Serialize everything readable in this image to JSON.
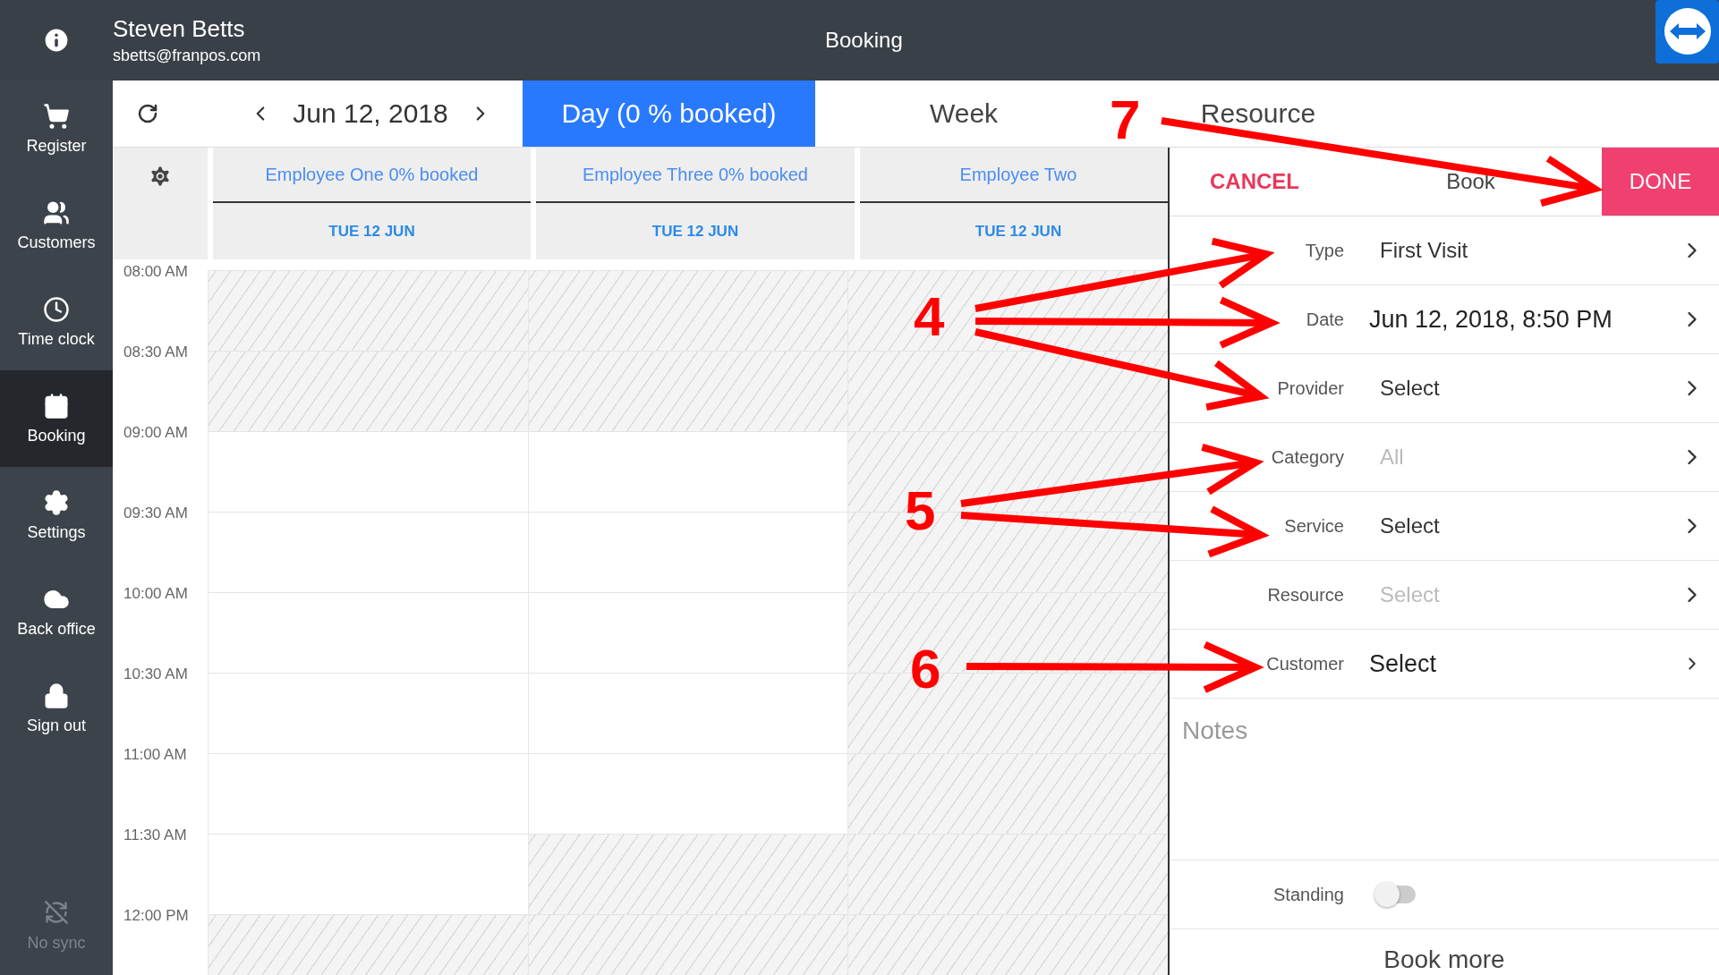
{
  "header": {
    "user_name": "Steven Betts",
    "user_email": "sbetts@franpos.com",
    "title": "Booking"
  },
  "sidebar": {
    "items": [
      {
        "label": "Register",
        "selected": false
      },
      {
        "label": "Customers",
        "selected": false
      },
      {
        "label": "Time clock",
        "selected": false
      },
      {
        "label": "Booking",
        "selected": true
      },
      {
        "label": "Settings",
        "selected": false
      },
      {
        "label": "Back office",
        "selected": false
      },
      {
        "label": "Sign out",
        "selected": false
      }
    ],
    "sync": {
      "label": "No sync",
      "disabled": true
    }
  },
  "toolbar": {
    "date": "Jun 12, 2018",
    "tabs": [
      {
        "label": "Day (0 % booked)",
        "selected": true
      },
      {
        "label": "Week",
        "selected": false
      },
      {
        "label": "Resource",
        "selected": false
      }
    ]
  },
  "calendar": {
    "times": [
      "08:00 AM",
      "08:30 AM",
      "09:00 AM",
      "09:30 AM",
      "10:00 AM",
      "10:30 AM",
      "11:00 AM",
      "11:30 AM",
      "12:00 PM"
    ],
    "columns": [
      {
        "name": "Employee One 0% booked",
        "date": "TUE 12 JUN",
        "slots": [
          {
            "blocked": true
          },
          {
            "blocked": true
          },
          {
            "blocked": false
          },
          {
            "blocked": false
          },
          {
            "blocked": false
          },
          {
            "blocked": false
          },
          {
            "blocked": false
          },
          {
            "blocked": false
          },
          {
            "blocked": true
          }
        ]
      },
      {
        "name": "Employee Three 0% booked",
        "date": "TUE 12 JUN",
        "slots": [
          {
            "blocked": true
          },
          {
            "blocked": true
          },
          {
            "blocked": false
          },
          {
            "blocked": false
          },
          {
            "blocked": false
          },
          {
            "blocked": false
          },
          {
            "blocked": false
          },
          {
            "blocked": true
          },
          {
            "blocked": true
          }
        ]
      },
      {
        "name": "Employee Two",
        "date": "TUE 12 JUN",
        "slots": [
          {
            "blocked": true
          },
          {
            "blocked": true
          },
          {
            "blocked": true
          },
          {
            "blocked": true
          },
          {
            "blocked": true
          },
          {
            "blocked": true
          },
          {
            "blocked": true
          },
          {
            "blocked": true
          },
          {
            "blocked": true
          }
        ]
      }
    ]
  },
  "booking_form": {
    "cancel": "CANCEL",
    "title": "Book",
    "done": "DONE",
    "fields": [
      {
        "label": "Type",
        "value": "First Visit",
        "muted": false,
        "large": false
      },
      {
        "label": "Date",
        "value": "Jun 12, 2018, 8:50 PM",
        "muted": false,
        "large": true
      },
      {
        "label": "Provider",
        "value": "Select",
        "muted": false,
        "large": false
      },
      {
        "label": "Category",
        "value": "All",
        "muted": true,
        "large": false
      },
      {
        "label": "Service",
        "value": "Select",
        "muted": false,
        "large": false
      },
      {
        "label": "Resource",
        "value": "Select",
        "muted": true,
        "large": false
      },
      {
        "label": "Customer",
        "value": "Select",
        "muted": false,
        "large": true
      }
    ],
    "notes": {
      "placeholder": "Notes"
    },
    "standing": {
      "label": "Standing",
      "on": false
    },
    "book_more": "Book more"
  },
  "annotations": [
    {
      "label": "7"
    },
    {
      "label": "4"
    },
    {
      "label": "5"
    },
    {
      "label": "6"
    }
  ]
}
